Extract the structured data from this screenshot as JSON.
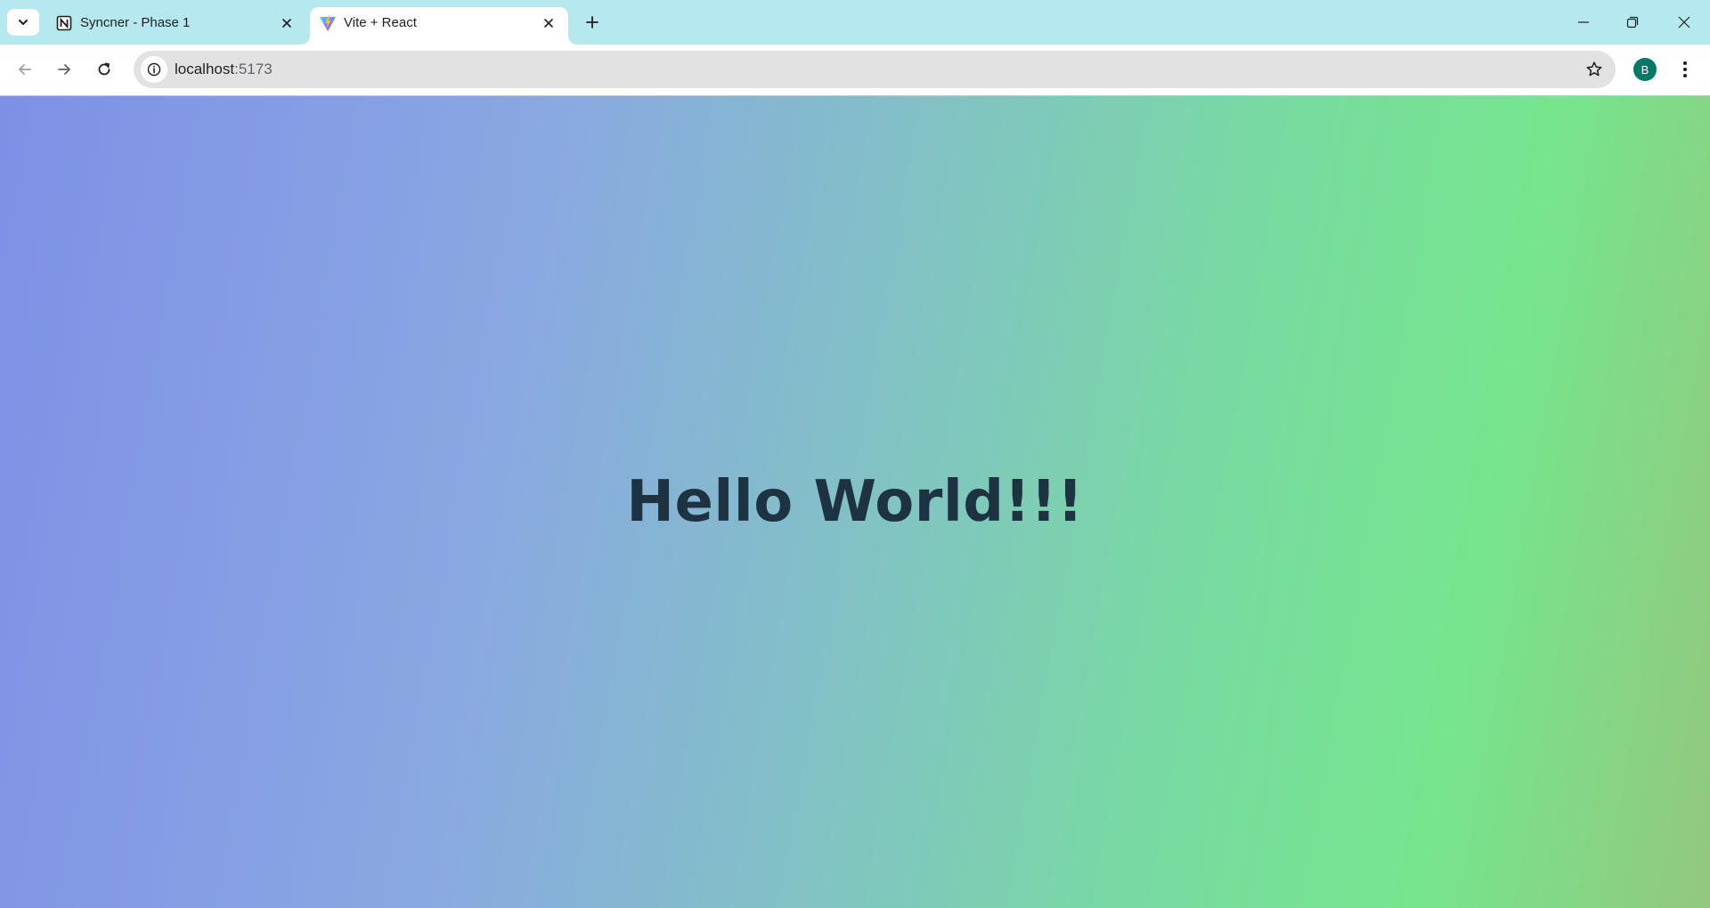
{
  "browser": {
    "tabs": [
      {
        "title": "Syncner - Phase 1",
        "favicon": "notion-icon",
        "active": false
      },
      {
        "title": "Vite + React",
        "favicon": "vite-icon",
        "active": true
      }
    ],
    "address": {
      "host": "localhost",
      "port": ":5173"
    },
    "profile": {
      "initial": "B",
      "color": "#00796b"
    },
    "icons": {
      "tab_search": "chevron-down-icon",
      "new_tab": "plus-icon",
      "back": "arrow-left-icon",
      "forward": "arrow-right-icon",
      "reload": "reload-icon",
      "site_info": "info-icon",
      "bookmark": "star-icon",
      "menu": "kebab-menu-icon",
      "minimize": "minimize-icon",
      "restore": "restore-icon",
      "close": "close-icon"
    },
    "colors": {
      "tabstrip": "#b6e8f0",
      "omnibox": "#e2e2e2"
    }
  },
  "page": {
    "heading": "Hello World!!!",
    "heading_color": "#1e3342",
    "gradient": [
      "#7e90e6",
      "#8aa8e2",
      "#82c1c6",
      "#78dba0",
      "#76e58e",
      "#93c87e"
    ]
  }
}
